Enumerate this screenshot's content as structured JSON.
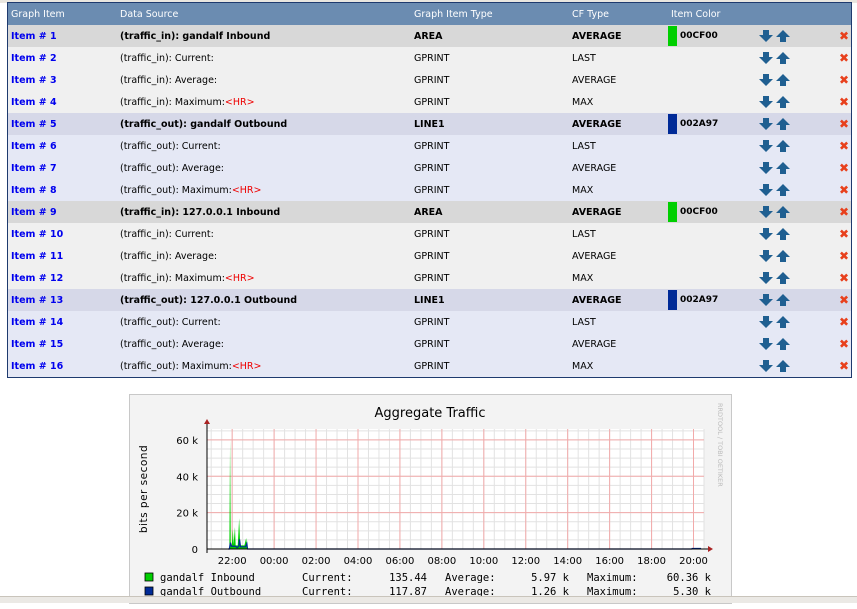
{
  "table": {
    "headers": [
      "Graph Item",
      "Data Source",
      "Graph Item Type",
      "CF Type",
      "Item Color"
    ],
    "rows": [
      {
        "item": "Item # 1",
        "source": "(traffic_in): gandalf Inbound",
        "hr": "",
        "type": "AREA",
        "cf": "AVERAGE",
        "color": "00CF00",
        "group": 0,
        "head": true
      },
      {
        "item": "Item # 2",
        "source": "(traffic_in): Current:",
        "hr": "",
        "type": "GPRINT",
        "cf": "LAST",
        "color": "",
        "group": 0,
        "head": false
      },
      {
        "item": "Item # 3",
        "source": "(traffic_in): Average:",
        "hr": "",
        "type": "GPRINT",
        "cf": "AVERAGE",
        "color": "",
        "group": 0,
        "head": false
      },
      {
        "item": "Item # 4",
        "source": "(traffic_in): Maximum:",
        "hr": "<HR>",
        "type": "GPRINT",
        "cf": "MAX",
        "color": "",
        "group": 0,
        "head": false
      },
      {
        "item": "Item # 5",
        "source": "(traffic_out): gandalf Outbound",
        "hr": "",
        "type": "LINE1",
        "cf": "AVERAGE",
        "color": "002A97",
        "group": 1,
        "head": true
      },
      {
        "item": "Item # 6",
        "source": "(traffic_out): Current:",
        "hr": "",
        "type": "GPRINT",
        "cf": "LAST",
        "color": "",
        "group": 1,
        "head": false
      },
      {
        "item": "Item # 7",
        "source": "(traffic_out): Average:",
        "hr": "",
        "type": "GPRINT",
        "cf": "AVERAGE",
        "color": "",
        "group": 1,
        "head": false
      },
      {
        "item": "Item # 8",
        "source": "(traffic_out): Maximum:",
        "hr": "<HR>",
        "type": "GPRINT",
        "cf": "MAX",
        "color": "",
        "group": 1,
        "head": false
      },
      {
        "item": "Item # 9",
        "source": "(traffic_in): 127.0.0.1 Inbound",
        "hr": "",
        "type": "AREA",
        "cf": "AVERAGE",
        "color": "00CF00",
        "group": 0,
        "head": true
      },
      {
        "item": "Item # 10",
        "source": "(traffic_in): Current:",
        "hr": "",
        "type": "GPRINT",
        "cf": "LAST",
        "color": "",
        "group": 0,
        "head": false
      },
      {
        "item": "Item # 11",
        "source": "(traffic_in): Average:",
        "hr": "",
        "type": "GPRINT",
        "cf": "AVERAGE",
        "color": "",
        "group": 0,
        "head": false
      },
      {
        "item": "Item # 12",
        "source": "(traffic_in): Maximum:",
        "hr": "<HR>",
        "type": "GPRINT",
        "cf": "MAX",
        "color": "",
        "group": 0,
        "head": false
      },
      {
        "item": "Item # 13",
        "source": "(traffic_out): 127.0.0.1 Outbound",
        "hr": "",
        "type": "LINE1",
        "cf": "AVERAGE",
        "color": "002A97",
        "group": 1,
        "head": true
      },
      {
        "item": "Item # 14",
        "source": "(traffic_out): Current:",
        "hr": "",
        "type": "GPRINT",
        "cf": "LAST",
        "color": "",
        "group": 1,
        "head": false
      },
      {
        "item": "Item # 15",
        "source": "(traffic_out): Average:",
        "hr": "",
        "type": "GPRINT",
        "cf": "AVERAGE",
        "color": "",
        "group": 1,
        "head": false
      },
      {
        "item": "Item # 16",
        "source": "(traffic_out): Maximum:",
        "hr": "<HR>",
        "type": "GPRINT",
        "cf": "MAX",
        "color": "",
        "group": 1,
        "head": false
      }
    ],
    "icons": {
      "down": "arrow-down-icon",
      "up": "arrow-up-icon",
      "delete": "delete-x-icon"
    },
    "arrow_color": "#1f5f91",
    "delete_color": "#e8401c"
  },
  "chart_data": {
    "type": "area",
    "title": "Aggregate Traffic",
    "ylabel": "bits per second",
    "watermark": "RRDTOOL / TOBI OETIKER",
    "ylim": [
      0,
      66000
    ],
    "yticks": [
      {
        "v": 0,
        "label": "0"
      },
      {
        "v": 20000,
        "label": "20 k"
      },
      {
        "v": 40000,
        "label": "40 k"
      },
      {
        "v": 60000,
        "label": "60 k"
      }
    ],
    "xrange": [
      "20:48",
      "20:30"
    ],
    "xticks": [
      "22:00",
      "00:00",
      "02:00",
      "04:00",
      "06:00",
      "08:00",
      "10:00",
      "12:00",
      "14:00",
      "16:00",
      "18:00",
      "20:00"
    ],
    "grid": true,
    "series": [
      {
        "name": "gandalf Inbound",
        "color": "#00CF00",
        "kind": "area",
        "points": [
          [
            "21:48",
            0
          ],
          [
            "21:52",
            0
          ],
          [
            "21:54",
            60360
          ],
          [
            "21:56",
            3000
          ],
          [
            "21:59",
            2000
          ],
          [
            "22:02",
            11000
          ],
          [
            "22:04",
            2500
          ],
          [
            "22:08",
            12000
          ],
          [
            "22:10",
            2000
          ],
          [
            "22:16",
            2000
          ],
          [
            "22:20",
            17000
          ],
          [
            "22:23",
            2000
          ],
          [
            "22:35",
            2000
          ],
          [
            "22:40",
            6000
          ],
          [
            "22:42",
            3000
          ],
          [
            "22:44",
            0
          ],
          [
            "19:55",
            0
          ],
          [
            "19:56",
            500
          ],
          [
            "20:20",
            500
          ],
          [
            "20:21",
            0
          ]
        ]
      },
      {
        "name": "gandalf Outbound",
        "color": "#002A97",
        "kind": "line",
        "points": [
          [
            "21:48",
            0
          ],
          [
            "21:52",
            0
          ],
          [
            "21:55",
            3500
          ],
          [
            "21:58",
            1500
          ],
          [
            "22:10",
            1500
          ],
          [
            "22:14",
            800
          ],
          [
            "22:19",
            1500
          ],
          [
            "22:21",
            5300
          ],
          [
            "22:24",
            1200
          ],
          [
            "22:38",
            1200
          ],
          [
            "22:42",
            3000
          ],
          [
            "22:44",
            0
          ],
          [
            "19:55",
            0
          ],
          [
            "19:56",
            300
          ],
          [
            "20:20",
            300
          ],
          [
            "20:21",
            0
          ]
        ]
      }
    ],
    "legend": [
      {
        "name": "gandalf Inbound",
        "color": "#00CF00",
        "current_label": "Current:",
        "current": "135.44",
        "average_label": "Average:",
        "average": "5.97 k",
        "maximum_label": "Maximum:",
        "maximum": "60.36 k"
      },
      {
        "name": "gandalf Outbound",
        "color": "#002A97",
        "current_label": "Current:",
        "current": "117.87",
        "average_label": "Average:",
        "average": "1.26 k",
        "maximum_label": "Maximum:",
        "maximum": "5.30 k"
      }
    ]
  }
}
